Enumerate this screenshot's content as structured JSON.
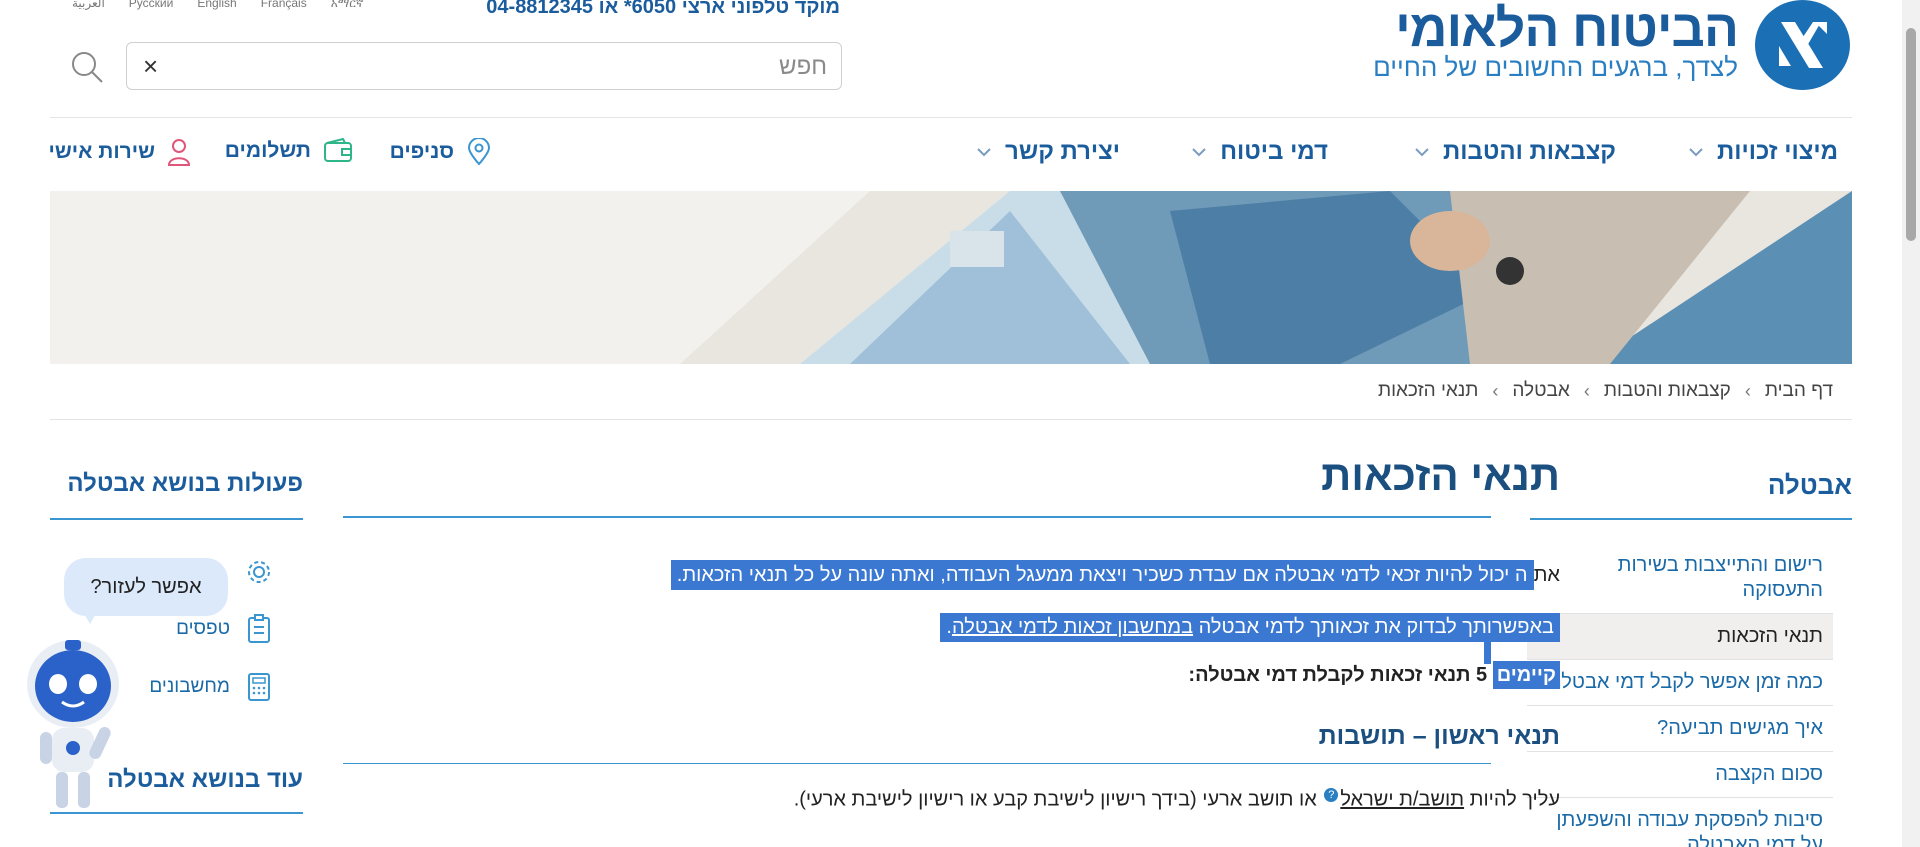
{
  "header": {
    "logo_title": "הביטוח הלאומי",
    "logo_subtitle": "לצדך, ברגעים החשובים של החיים",
    "phone": "מוקד טלפוני ארצי 6050* או 04-8812345",
    "languages": [
      "العربية",
      "Русский",
      "English",
      "Français",
      "አማርኛ"
    ]
  },
  "search": {
    "placeholder": "חפש",
    "clear_label": "×"
  },
  "nav": {
    "items": [
      "מיצוי זכויות",
      "קצבאות והטבות",
      "דמי ביטוח",
      "יצירת קשר"
    ],
    "utilities": [
      "סניפים",
      "תשלומים",
      "שירות אישי"
    ]
  },
  "breadcrumb": [
    "דף הבית",
    "קצבאות והטבות",
    "אבטלה",
    "תנאי הזכאות"
  ],
  "sidebar": {
    "title": "אבטלה",
    "items": [
      "רישום והתייצבות בשירות התעסוקה",
      "תנאי הזכאות",
      "כמה זמן אפשר לקבל דמי אבטלה?",
      "איך מגישים תביעה?",
      "סכום הקצבה",
      "סיבות להפסקת עבודה והשפעתן על דמי האבטלה"
    ]
  },
  "main": {
    "title": "תנאי הזכאות",
    "p1_prefix": "את",
    "p1_selected": "ה יכול להיות זכאי לדמי אבטלה אם עבדת כשכיר ויצאת ממעגל העבודה, ואתה עונה על כל תנאי הזכאות.",
    "p2_text": "באפשרותך לבדוק את זכאותך לדמי אבטלה ",
    "p2_link": "במחשבון זכאות לדמי אבטלה",
    "p2_end": ".",
    "p3_selected": "קיימים",
    "p3_rest": " 5 תנאי זכאות לקבלת דמי אבטלה:",
    "section1_title": "תנאי ראשון – תושבות",
    "p4_prefix": "עליך להיות ",
    "p4_link": "תושב/ת ישראל",
    "p4_qmark": "?",
    "p4_rest": " או תושב ארעי (בידך רישיון לישיבת קבע או רישיון לישיבת ארעי)."
  },
  "actions": {
    "title": "פעולות בנושא אבטלה",
    "items": [
      "",
      "טפסים",
      "מחשבונים"
    ],
    "more_title": "עוד בנושא אבטלה"
  },
  "assistant": {
    "bubble": "אפשר לעזור?"
  },
  "colors": {
    "brand_blue": "#1b5c9c",
    "accent_line": "#3a96d0",
    "selection": "#3a78d2"
  }
}
